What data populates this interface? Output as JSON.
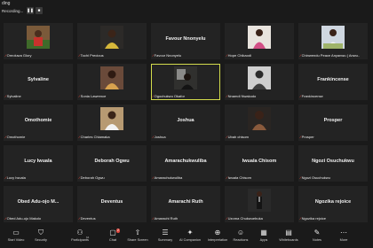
{
  "window": {
    "title": "ding",
    "recording_label": "Recording..."
  },
  "tiles": [
    {
      "name": "",
      "label": "Oreoluwa Glory",
      "has_photo": true,
      "photo": "person-red"
    },
    {
      "name": "",
      "label": "Tochi Precious",
      "has_photo": true,
      "photo": "person-yellow"
    },
    {
      "name": "Favour Nnonyelu",
      "label": "Favour Nnonyelu",
      "has_photo": false
    },
    {
      "name": "",
      "label": "Hope Chikaodi",
      "has_photo": true,
      "photo": "person-pink"
    },
    {
      "name": "",
      "label": "Chinwendu Peace Anyanwu ( Anwu..",
      "has_photo": true,
      "photo": "person-white"
    },
    {
      "name": "Sylvaline",
      "label": "Sylvaline",
      "has_photo": false
    },
    {
      "name": "",
      "label": "Sonia Lawrence",
      "has_photo": true,
      "photo": "person-orange"
    },
    {
      "name": "",
      "label": "Ogochukwu Okafor",
      "has_photo": true,
      "photo": "person-dark",
      "active": true
    },
    {
      "name": "",
      "label": "Nnamdi Nwakodo",
      "has_photo": true,
      "photo": "person-grey"
    },
    {
      "name": "Frankincense",
      "label": "Frankincense",
      "has_photo": false
    },
    {
      "name": "Omothomie",
      "label": "Omothomie",
      "has_photo": false
    },
    {
      "name": "",
      "label": "Charles Chiamaka",
      "has_photo": true,
      "photo": "person-brown"
    },
    {
      "name": "Joshua",
      "label": "Joshua",
      "has_photo": false
    },
    {
      "name": "",
      "label": "Ubah chisom",
      "has_photo": true,
      "photo": "person-dark2"
    },
    {
      "name": "Prosper",
      "label": "Prosper",
      "has_photo": false
    },
    {
      "name": "Lucy Iwuala",
      "label": "Lucy Iwuala",
      "has_photo": false
    },
    {
      "name": "Deborah Ogwu",
      "label": "Deborah Ogwu",
      "has_photo": false
    },
    {
      "name": "Amarachukwuliba",
      "label": "Amarachukwuliba",
      "has_photo": false
    },
    {
      "name": "Iwuala Chisom",
      "label": "Iwuala Chisom",
      "has_photo": false
    },
    {
      "name": "Ngozi Osuchukwu",
      "label": "Ngozi Osuchukwu",
      "has_photo": false
    },
    {
      "name": "Obed Adu-ojo M...",
      "label": "Obed Adu-ojo Makolo",
      "has_photo": false
    },
    {
      "name": "Deventus",
      "label": "Deventus",
      "has_photo": false
    },
    {
      "name": "Amarachi Ruth",
      "label": "Amarachi Ruth",
      "has_photo": false
    },
    {
      "name": "",
      "label": "Uzoma Chukwuebuka",
      "has_photo": true,
      "photo": "person-suit"
    },
    {
      "name": "Ngozika rejoice",
      "label": "Ngozika rejoice",
      "has_photo": false
    }
  ],
  "toolbar": {
    "items": [
      {
        "label": "Start Video",
        "icon": "video-icon",
        "glyph": "▭"
      },
      {
        "label": "Security",
        "icon": "shield-icon",
        "glyph": "⛉"
      },
      {
        "label": "Participants",
        "icon": "participants-icon",
        "glyph": "⚇"
      },
      {
        "label": "Chat",
        "icon": "chat-icon",
        "glyph": "▢"
      },
      {
        "label": "Share Screen",
        "icon": "share-screen-icon",
        "glyph": "⇧"
      },
      {
        "label": "Summary",
        "icon": "summary-icon",
        "glyph": "☰"
      },
      {
        "label": "AI Companion",
        "icon": "ai-companion-icon",
        "glyph": "✦"
      },
      {
        "label": "Interpretation",
        "icon": "interpretation-icon",
        "glyph": "⊕"
      },
      {
        "label": "Reactions",
        "icon": "reactions-icon",
        "glyph": "☺"
      },
      {
        "label": "Apps",
        "icon": "apps-icon",
        "glyph": "▦"
      },
      {
        "label": "Whiteboards",
        "icon": "whiteboard-icon",
        "glyph": "▤"
      },
      {
        "label": "Notes",
        "icon": "notes-icon",
        "glyph": "✎"
      },
      {
        "label": "More",
        "icon": "more-icon",
        "glyph": "⋯"
      }
    ],
    "participant_count": "64",
    "chat_badge": "2"
  },
  "colors": {
    "background": "#1a1a1a",
    "tile": "#232323",
    "active_border": "#d3dc4c",
    "mic_muted": "#e0483e"
  }
}
